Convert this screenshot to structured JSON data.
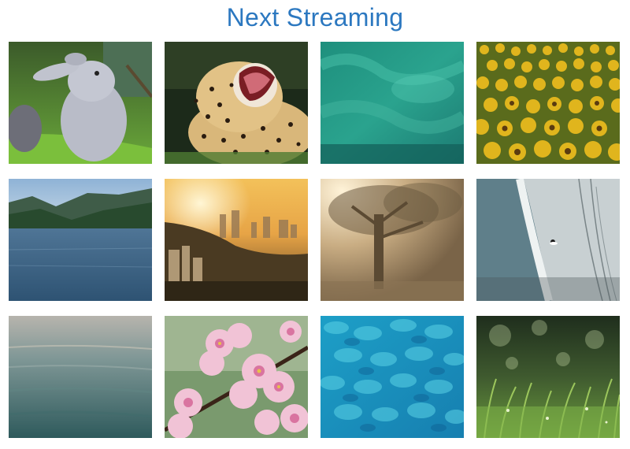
{
  "header": {
    "title": "Next Streaming"
  },
  "videos": [
    {
      "subject": "cartoon-bunny"
    },
    {
      "subject": "yawning-cheetah"
    },
    {
      "subject": "teal-underwater"
    },
    {
      "subject": "sunflower-field"
    },
    {
      "subject": "mountain-lake"
    },
    {
      "subject": "city-sunrise"
    },
    {
      "subject": "misty-tree"
    },
    {
      "subject": "aerial-beach-surfer"
    },
    {
      "subject": "calm-sea"
    },
    {
      "subject": "cherry-blossoms"
    },
    {
      "subject": "blue-water-ripples"
    },
    {
      "subject": "dewy-grass"
    }
  ],
  "colors": {
    "title": "#2c78c0",
    "background": "#ffffff"
  }
}
